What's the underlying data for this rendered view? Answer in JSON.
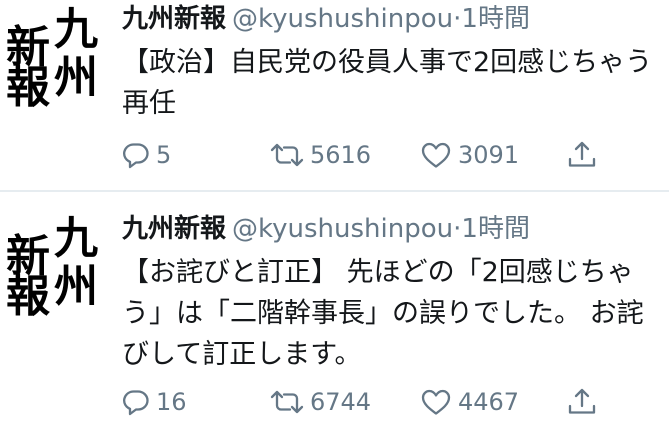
{
  "tweets": [
    {
      "avatar": {
        "top_right": "九",
        "top_left": "新",
        "bottom_right": "州",
        "bottom_left": "報"
      },
      "display_name": "九州新報",
      "handle": "@kyushushinpou",
      "dot": "·",
      "time": "1時間",
      "text": "【政治】自民党の役員人事で2回感じちゃう\n再任",
      "reply_count": "5",
      "retweet_count": "5616",
      "like_count": "3091"
    },
    {
      "avatar": {
        "top_right": "九",
        "top_left": "新",
        "bottom_right": "州",
        "bottom_left": "報"
      },
      "display_name": "九州新報",
      "handle": "@kyushushinpou",
      "dot": "·",
      "time": "1時間",
      "text": "【お詫びと訂正】 先ほどの「2回感じちゃ\nう」は「二階幹事長」の誤りでした。 お詫\nびして訂正します。",
      "reply_count": "16",
      "retweet_count": "6744",
      "like_count": "4467"
    }
  ],
  "icons": {
    "reply": "reply-icon",
    "retweet": "retweet-icon",
    "like": "heart-icon",
    "share": "share-icon"
  },
  "colors": {
    "text": "#14171a",
    "secondary": "#657786",
    "divider": "#e6ecf0"
  }
}
